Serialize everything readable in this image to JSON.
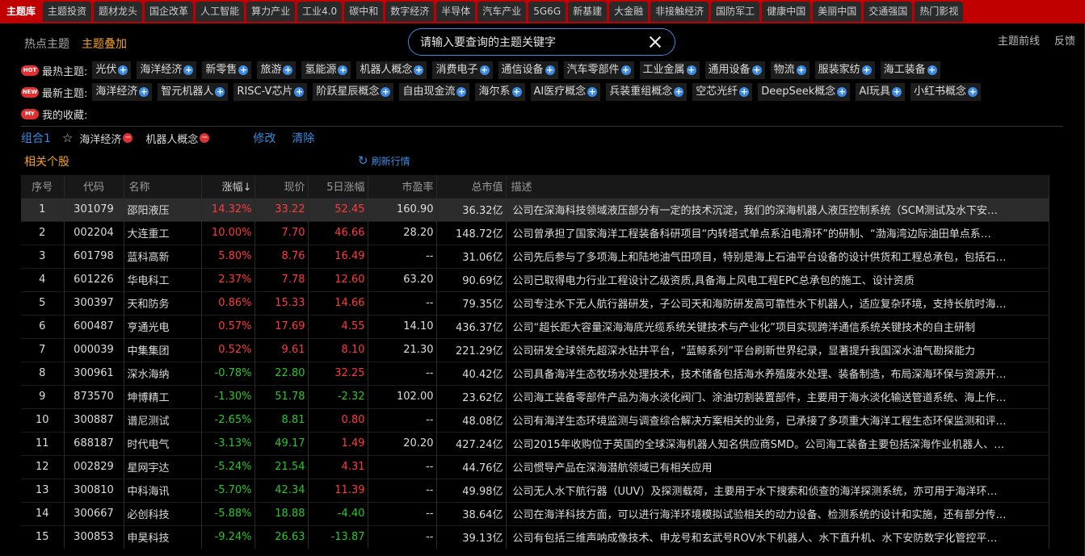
{
  "tabs": [
    "主题库",
    "主题投资",
    "题材龙头",
    "国企改革",
    "人工智能",
    "算力产业",
    "工业4.0",
    "碳中和",
    "数字经济",
    "半导体",
    "汽车产业",
    "5G6G",
    "新基建",
    "大金融",
    "非接触经济",
    "国防军工",
    "健康中国",
    "美丽中国",
    "交通强国",
    "热门影视"
  ],
  "subnav": {
    "hot_topics": "热点主题",
    "overlay": "主题叠加",
    "front": "主题前线",
    "feedback": "反馈"
  },
  "search": {
    "placeholder": "请输入要查询的主题关键字"
  },
  "hot": {
    "badge": "HOT",
    "label": "最热主题:",
    "items": [
      "光伏",
      "海洋经济",
      "新零售",
      "旅游",
      "氢能源",
      "机器人概念",
      "消费电子",
      "通信设备",
      "汽车零部件",
      "工业金属",
      "通用设备",
      "物流",
      "服装家纺",
      "海工装备"
    ]
  },
  "new": {
    "badge": "NEW",
    "label": "最新主题:",
    "items": [
      "海洋经济",
      "智元机器人",
      "RISC-V芯片",
      "阶跃星辰概念",
      "自由现金流",
      "海尔系",
      "AI医疗概念",
      "兵装重组概念",
      "空芯光纤",
      "DeepSeek概念",
      "AI玩具",
      "小红书概念"
    ]
  },
  "fav": {
    "badge": "MY",
    "label": "我的收藏:"
  },
  "combo": {
    "name": "组合1",
    "tags": [
      "海洋经济",
      "机器人概念"
    ],
    "edit": "修改",
    "clear": "清除"
  },
  "related_label": "相关个股",
  "refresh_label": "刷新行情",
  "table": {
    "headers": [
      "序号",
      "代码",
      "名称",
      "涨幅↓",
      "现价",
      "5日涨幅",
      "市盈率",
      "总市值",
      "描述"
    ],
    "rows": [
      {
        "no": "1",
        "code": "301079",
        "name": "邵阳液压",
        "chg": "14.32%",
        "price": "33.22",
        "chg5": "52.45",
        "pe": "160.90",
        "cap": "36.32亿",
        "desc": "公司在深海科技领域液压部分有一定的技术沉淀，我们的深海机器人液压控制系统（SCM测试及水下安…",
        "dir": "up",
        "dir5": "up"
      },
      {
        "no": "2",
        "code": "002204",
        "name": "大连重工",
        "chg": "10.00%",
        "price": "7.70",
        "chg5": "46.66",
        "pe": "28.20",
        "cap": "148.72亿",
        "desc": "公司曾承担了国家海洋工程装备科研项目“内转塔式单点系泊电滑环”的研制、“渤海湾边际油田单点系…",
        "dir": "up",
        "dir5": "up"
      },
      {
        "no": "3",
        "code": "601798",
        "name": "蓝科高新",
        "chg": "5.80%",
        "price": "8.76",
        "chg5": "16.49",
        "pe": "--",
        "cap": "31.06亿",
        "desc": "公司先后参与了多项海上和陆地油气田项目，特别是海上石油平台设备的设计供货和工程总承包，包括石…",
        "dir": "up",
        "dir5": "up"
      },
      {
        "no": "4",
        "code": "601226",
        "name": "华电科工",
        "chg": "2.37%",
        "price": "7.78",
        "chg5": "12.60",
        "pe": "63.20",
        "cap": "90.69亿",
        "desc": "公司已取得电力行业工程设计乙级资质,具备海上风电工程EPC总承包的施工、设计资质",
        "dir": "up",
        "dir5": "up"
      },
      {
        "no": "5",
        "code": "300397",
        "name": "天和防务",
        "chg": "0.86%",
        "price": "15.33",
        "chg5": "14.66",
        "pe": "--",
        "cap": "79.35亿",
        "desc": "公司专注水下无人航行器研发，子公司天和海防研发高可靠性水下机器人，适应复杂环境，支持长航时海…",
        "dir": "up",
        "dir5": "up"
      },
      {
        "no": "6",
        "code": "600487",
        "name": "亨通光电",
        "chg": "0.57%",
        "price": "17.69",
        "chg5": "4.55",
        "pe": "14.10",
        "cap": "436.37亿",
        "desc": "公司“超长距大容量深海海底光缆系统关键技术与产业化”项目实现跨洋通信系统关键技术的自主研制",
        "dir": "up",
        "dir5": "up"
      },
      {
        "no": "7",
        "code": "000039",
        "name": "中集集团",
        "chg": "0.52%",
        "price": "9.61",
        "chg5": "8.10",
        "pe": "21.30",
        "cap": "221.29亿",
        "desc": "公司研发全球领先超深水钻井平台，“蓝鲸系列”平台刷新世界纪录，显著提升我国深水油气勘探能力",
        "dir": "up",
        "dir5": "up"
      },
      {
        "no": "8",
        "code": "300961",
        "name": "深水海纳",
        "chg": "-0.78%",
        "price": "22.80",
        "chg5": "32.25",
        "pe": "--",
        "cap": "40.42亿",
        "desc": "公司具备海洋生态牧场水处理技术，技术储备包括海水养殖废水处理、装备制造，布局深海环保与资源开…",
        "dir": "down",
        "dir5": "up"
      },
      {
        "no": "9",
        "code": "873570",
        "name": "坤博精工",
        "chg": "-1.30%",
        "price": "51.78",
        "chg5": "-2.32",
        "pe": "102.00",
        "cap": "23.62亿",
        "desc": "公司海工装备零部件产品为海水淡化阀门、涂油切割装置部件，主要用于海水淡化输送管道系统、海上作…",
        "dir": "down",
        "dir5": "down"
      },
      {
        "no": "10",
        "code": "300887",
        "name": "谱尼测试",
        "chg": "-2.65%",
        "price": "8.81",
        "chg5": "0.80",
        "pe": "--",
        "cap": "48.08亿",
        "desc": "公司有海洋生态环境监测与调查综合解决方案相关的业务，已承接了多项重大海洋工程生态环保监测和评…",
        "dir": "down",
        "dir5": "up"
      },
      {
        "no": "11",
        "code": "688187",
        "name": "时代电气",
        "chg": "-3.13%",
        "price": "49.17",
        "chg5": "1.49",
        "pe": "20.20",
        "cap": "427.24亿",
        "desc": "公司2015年收购位于英国的全球深海机器人知名供应商SMD。公司海工装备主要包括深海作业机器人、…",
        "dir": "down",
        "dir5": "up"
      },
      {
        "no": "12",
        "code": "002829",
        "name": "星网宇达",
        "chg": "-5.24%",
        "price": "21.54",
        "chg5": "4.31",
        "pe": "--",
        "cap": "44.76亿",
        "desc": "公司惯导产品在深海潜航领域已有相关应用",
        "dir": "down",
        "dir5": "up"
      },
      {
        "no": "13",
        "code": "300810",
        "name": "中科海讯",
        "chg": "-5.70%",
        "price": "42.34",
        "chg5": "11.39",
        "pe": "--",
        "cap": "49.98亿",
        "desc": "公司无人水下航行器（UUV）及探测载荷，主要用于水下搜索和侦查的海洋探测系统，亦可用于海洋环…",
        "dir": "down",
        "dir5": "up"
      },
      {
        "no": "14",
        "code": "300667",
        "name": "必创科技",
        "chg": "-5.88%",
        "price": "18.88",
        "chg5": "-4.40",
        "pe": "--",
        "cap": "38.64亿",
        "desc": "公司在海洋科技方面，可以进行海洋环境模拟试验相关的动力设备、检测系统的设计和实施，还有部分传…",
        "dir": "down",
        "dir5": "down"
      },
      {
        "no": "15",
        "code": "300853",
        "name": "申昊科技",
        "chg": "-9.24%",
        "price": "26.63",
        "chg5": "-13.87",
        "pe": "--",
        "cap": "39.13亿",
        "desc": "公司有包括三维声呐成像技术、申龙号和玄武号ROV水下机器人、水下直升机、水下安防数字化管控平…",
        "dir": "down",
        "dir5": "down"
      }
    ]
  },
  "colors": {
    "up": "#ff3a3a",
    "down": "#28c828",
    "accent": "#3d8be0",
    "highlight": "#f2a026",
    "tab_red": "#c00000"
  }
}
